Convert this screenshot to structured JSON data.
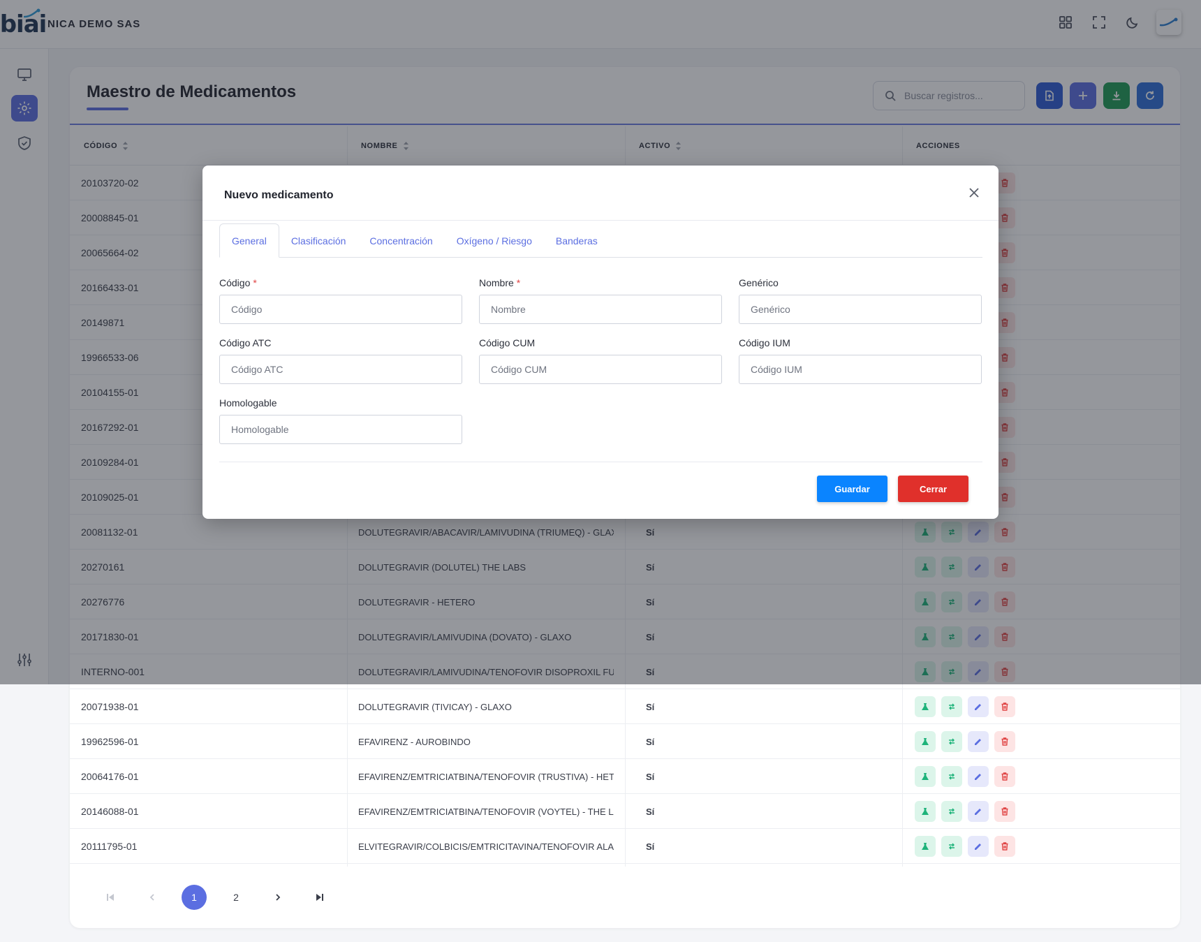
{
  "header": {
    "logo_text": "biai",
    "company": "NICA DEMO SAS",
    "icons": [
      "grid-icon",
      "fullscreen-icon",
      "moon-icon",
      "user-avatar"
    ]
  },
  "sidebar": {
    "items": [
      "monitor-icon",
      "gear-icon",
      "shield-check-icon"
    ],
    "bottom": "sliders-icon"
  },
  "page": {
    "title": "Maestro de Medicamentos",
    "search_placeholder": "Buscar registros...",
    "colors": {
      "accent": "#5b6ee1",
      "primary": "#2f5bd3",
      "success": "#1f9b55",
      "danger": "#e0302b",
      "save": "#0a84ff"
    }
  },
  "table": {
    "columns": [
      "CÓDIGO",
      "NOMBRE",
      "ACTIVO",
      "ACCIONES"
    ],
    "rows": [
      {
        "code": "20103720-02",
        "name": "",
        "active": ""
      },
      {
        "code": "20008845-01",
        "name": "",
        "active": ""
      },
      {
        "code": "20065664-02",
        "name": "",
        "active": ""
      },
      {
        "code": "20166433-01",
        "name": "",
        "active": ""
      },
      {
        "code": "20149871",
        "name": "",
        "active": ""
      },
      {
        "code": "19966533-06",
        "name": "",
        "active": ""
      },
      {
        "code": "20104155-01",
        "name": "",
        "active": ""
      },
      {
        "code": "20167292-01",
        "name": "",
        "active": ""
      },
      {
        "code": "20109284-01",
        "name": "",
        "active": ""
      },
      {
        "code": "20109025-01",
        "name": "",
        "active": ""
      },
      {
        "code": "20081132-01",
        "name": "DOLUTEGRAVIR/ABACAVIR/LAMIVUDINA (TRIUMEQ) - GLAXO",
        "active": "Sí"
      },
      {
        "code": "20270161",
        "name": "DOLUTEGRAVIR (DOLUTEL) THE LABS",
        "active": "Sí"
      },
      {
        "code": "20276776",
        "name": "DOLUTEGRAVIR - HETERO",
        "active": "Sí"
      },
      {
        "code": "20171830-01",
        "name": "DOLUTEGRAVIR/LAMIVUDINA (DOVATO) - GLAXO",
        "active": "Sí"
      },
      {
        "code": "INTERNO-001",
        "name": "DOLUTEGRAVIR/LAMIVUDINA/TENOFOVIR DISOPROXIL FUMARATO",
        "active": "Sí"
      },
      {
        "code": "20071938-01",
        "name": "DOLUTEGRAVIR (TIVICAY) - GLAXO",
        "active": "Sí"
      },
      {
        "code": "19962596-01",
        "name": "EFAVIRENZ - AUROBINDO",
        "active": "Sí"
      },
      {
        "code": "20064176-01",
        "name": "EFAVIRENZ/EMTRICIATBINA/TENOFOVIR (TRUSTIVA) - HETERO",
        "active": "Sí"
      },
      {
        "code": "20146088-01",
        "name": "EFAVIRENZ/EMTRICIATBINA/TENOFOVIR (VOYTEL) - THE LABS",
        "active": "Sí"
      },
      {
        "code": "20111795-01",
        "name": "ELVITEGRAVIR/COLBICIS/EMTRICITAVINA/TENOFOVIR ALAFENAMIDA",
        "active": "Sí"
      }
    ]
  },
  "pagination": {
    "pages": [
      "1",
      "2"
    ],
    "current": "1"
  },
  "modal": {
    "title": "Nuevo medicamento",
    "tabs": [
      "General",
      "Clasificación",
      "Concentración",
      "Oxígeno / Riesgo",
      "Banderas"
    ],
    "fields": {
      "codigo": {
        "label": "Código",
        "placeholder": "Código",
        "required": "*"
      },
      "nombre": {
        "label": "Nombre",
        "placeholder": "Nombre",
        "required": "*"
      },
      "generico": {
        "label": "Genérico",
        "placeholder": "Genérico"
      },
      "atc": {
        "label": "Código ATC",
        "placeholder": "Código ATC"
      },
      "cum": {
        "label": "Código CUM",
        "placeholder": "Código CUM"
      },
      "ium": {
        "label": "Código IUM",
        "placeholder": "Código IUM"
      },
      "homologable": {
        "label": "Homologable",
        "placeholder": "Homologable"
      }
    },
    "save_label": "Guardar",
    "close_label": "Cerrar"
  }
}
